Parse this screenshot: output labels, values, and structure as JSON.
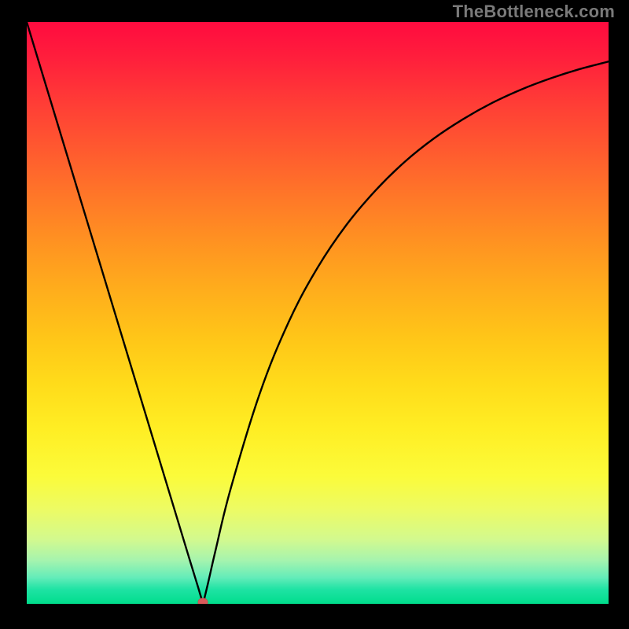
{
  "watermark": "TheBottleneck.com",
  "colors": {
    "frame": "#000000",
    "watermark_text": "#7a7a7a",
    "curve_stroke": "#000000",
    "marker": "#d85a5a",
    "gradient_top": "#ff0b3f",
    "gradient_bottom": "#00dd8c"
  },
  "chart_data": {
    "type": "line",
    "title": "",
    "xlabel": "",
    "ylabel": "",
    "xlim": [
      0,
      1
    ],
    "ylim": [
      0,
      1
    ],
    "annotations": [
      "TheBottleneck.com"
    ],
    "marker": {
      "x": 0.303,
      "y": 0.0
    },
    "series": [
      {
        "name": "curve",
        "x": [
          0.0,
          0.05,
          0.1,
          0.15,
          0.2,
          0.25,
          0.28,
          0.295,
          0.303,
          0.311,
          0.325,
          0.35,
          0.4,
          0.45,
          0.5,
          0.55,
          0.6,
          0.65,
          0.7,
          0.75,
          0.8,
          0.85,
          0.9,
          0.95,
          1.0
        ],
        "y": [
          1.0,
          0.835,
          0.67,
          0.505,
          0.34,
          0.175,
          0.076,
          0.027,
          0.0,
          0.033,
          0.094,
          0.196,
          0.36,
          0.484,
          0.578,
          0.652,
          0.711,
          0.76,
          0.8,
          0.833,
          0.861,
          0.884,
          0.903,
          0.919,
          0.932
        ]
      }
    ]
  }
}
